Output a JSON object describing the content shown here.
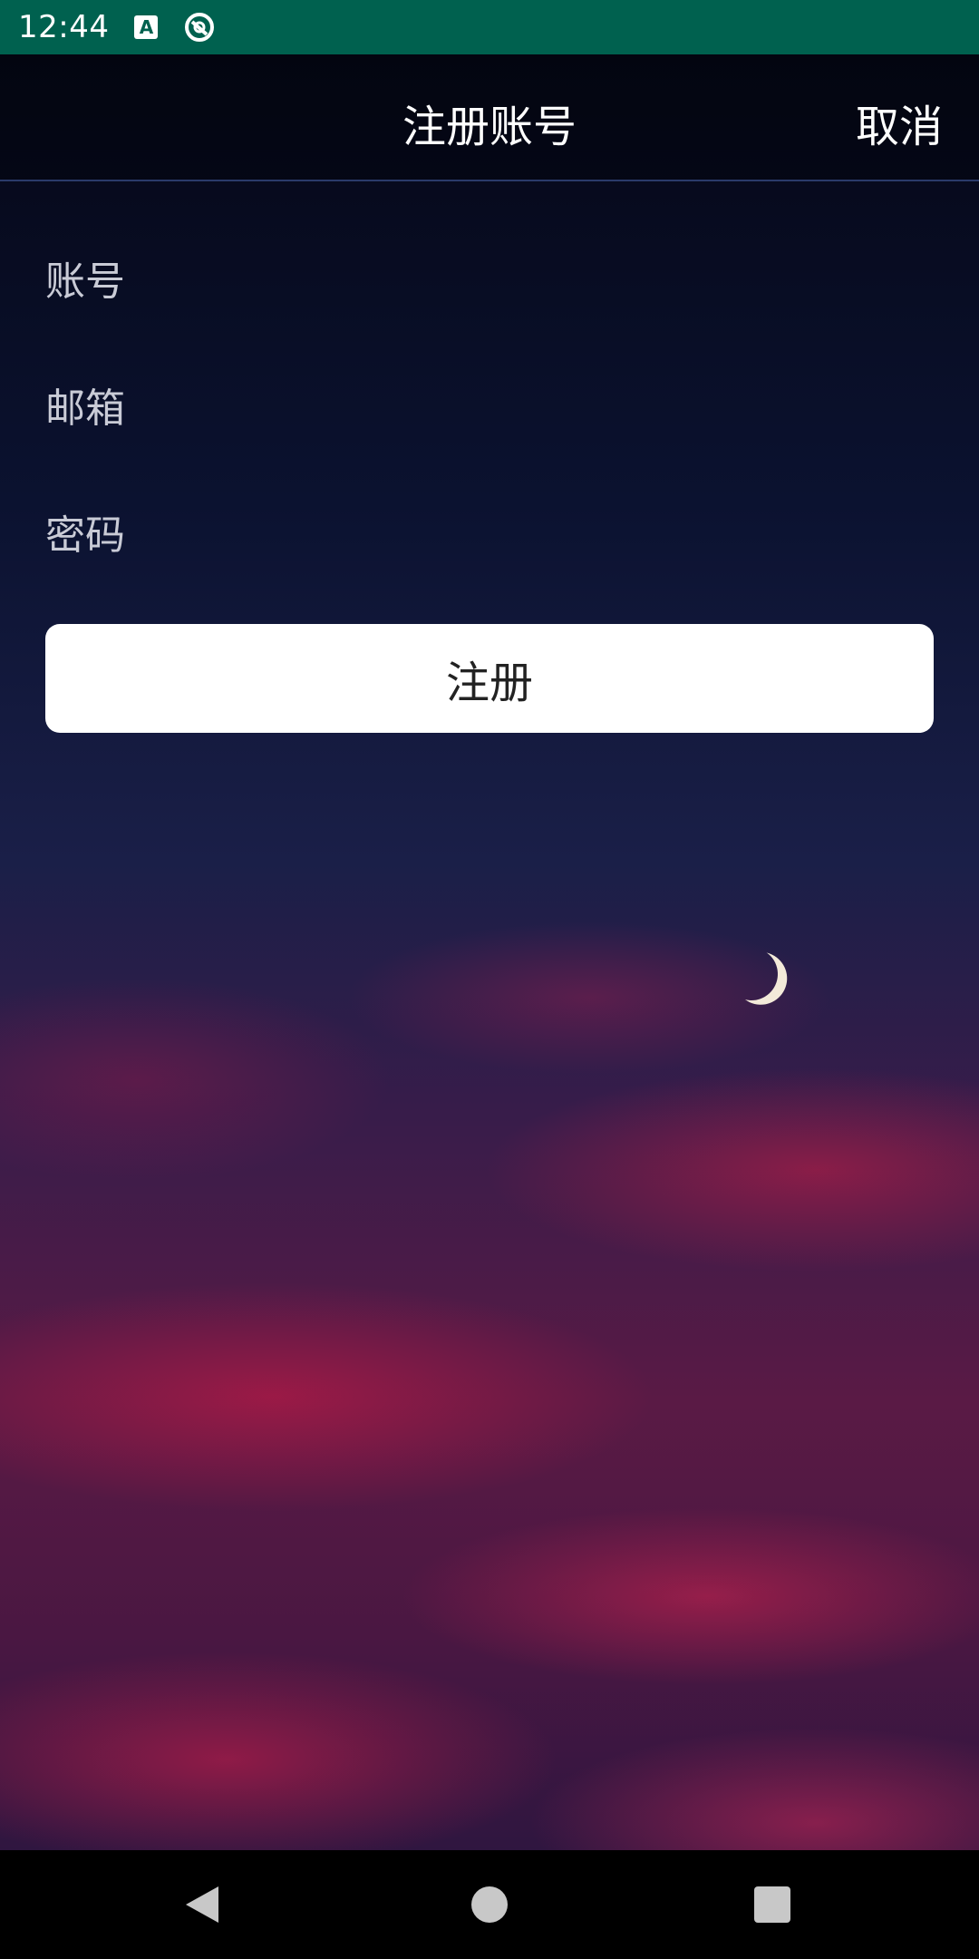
{
  "status_bar": {
    "time": "12:44",
    "icons": [
      "a-keyboard-icon",
      "sync-icon"
    ]
  },
  "header": {
    "title": "注册账号",
    "cancel_label": "取消"
  },
  "form": {
    "account_placeholder": "账号",
    "email_placeholder": "邮箱",
    "password_placeholder": "密码",
    "register_label": "注册"
  },
  "nav_bar": {
    "icons": [
      "back-icon",
      "home-icon",
      "recents-icon"
    ]
  },
  "colors": {
    "status_bar": "#00614f",
    "button_bg": "#ffffff",
    "text_primary": "#ffffff",
    "text_hint": "#c9cbd6"
  }
}
